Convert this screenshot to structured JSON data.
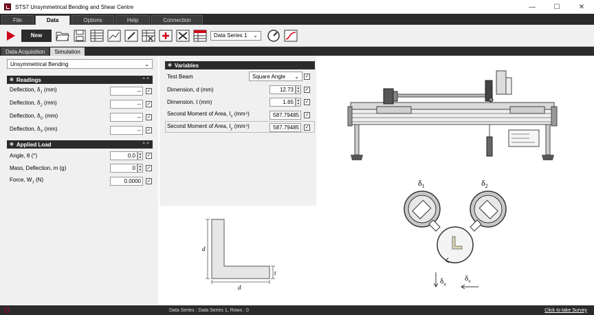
{
  "window": {
    "title": "STS7 Unsymmetrical Bending and Shear Centre"
  },
  "menu": {
    "tabs": [
      "File",
      "Data",
      "Options",
      "Help",
      "Connection"
    ],
    "active": "Data"
  },
  "toolbar": {
    "new_label": "New",
    "data_series": "Data Series 1"
  },
  "subtabs": {
    "items": [
      "Data Acquisition",
      "Simulation"
    ],
    "active": "Simulation"
  },
  "experiment": {
    "selected": "Unsymmetrical Bending"
  },
  "readings": {
    "title": "Readings",
    "rows": [
      {
        "label": "Deflection, δ",
        "sub": "1",
        "unit": "(mm)",
        "value": "--"
      },
      {
        "label": "Deflection, δ",
        "sub": "2",
        "unit": "(mm)",
        "value": "--"
      },
      {
        "label": "Deflection, δ",
        "sub": "U",
        "unit": "(mm)",
        "value": "--"
      },
      {
        "label": "Deflection, δ",
        "sub": "V",
        "unit": "(mm)",
        "value": "--"
      }
    ]
  },
  "applied_load": {
    "title": "Applied Load",
    "angle_label": "Angle, θ (°)",
    "angle_value": "0.0",
    "mass_label": "Mass, Deflection, m (g)",
    "mass_value": "0",
    "force_label": "Force, W",
    "force_sub": "1",
    "force_unit": "(N)",
    "force_value": "0.0000"
  },
  "variables": {
    "title": "Variables",
    "test_beam_label": "Test Beam",
    "test_beam_value": "Square Angle",
    "dim_d_label": "Dimension, d (mm)",
    "dim_d_value": "12.73",
    "dim_t_label": "Dimension, t (mm)",
    "dim_t_value": "1.65",
    "ix_label": "Second Moment of Area, I",
    "ix_sub": "x",
    "ix_unit": "(mm⁴)",
    "ix_value": "587.79485",
    "iy_label": "Second Moment of Area, I",
    "iy_sub": "y",
    "iy_unit": "(mm⁴)",
    "iy_value": "587.79485"
  },
  "section_diagram": {
    "d_left": "d",
    "t_right": "t",
    "d_bottom": "d"
  },
  "gauge_diagram": {
    "delta1": "δ",
    "delta1_sub": "1",
    "delta2": "δ",
    "delta2_sub": "2",
    "delta_u": "δ",
    "delta_u_sub": "u",
    "delta_v": "δ",
    "delta_v_sub": "v"
  },
  "status": {
    "text": "Data Series : Data Series 1,  Rows : 0",
    "survey": "Click to take Survey"
  },
  "colors": {
    "dark": "#2b2b2b",
    "accent_red": "#d0021b"
  }
}
